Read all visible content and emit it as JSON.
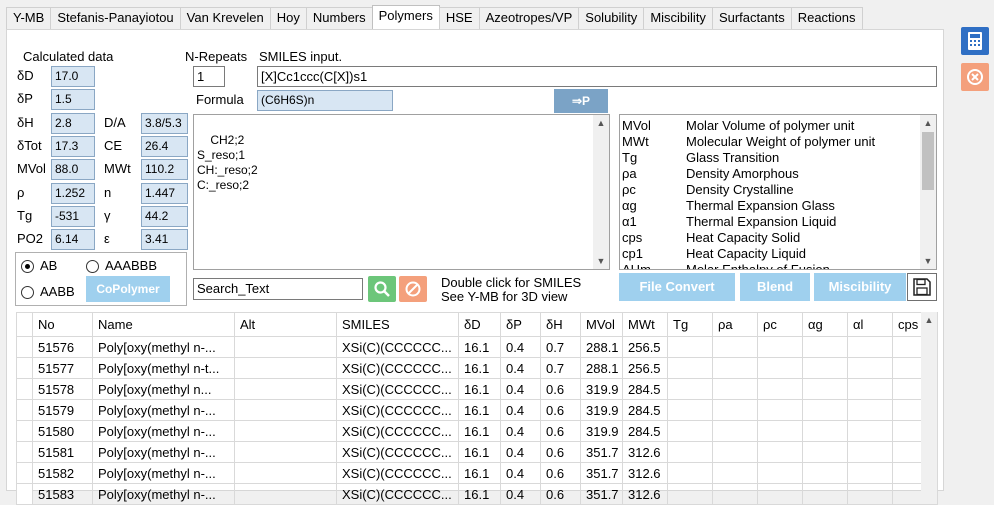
{
  "tabs": [
    "Y-MB",
    "Stefanis-Panayiotou",
    "Van Krevelen",
    "Hoy",
    "Numbers",
    "Polymers",
    "HSE",
    "Azeotropes/VP",
    "Solubility",
    "Miscibility",
    "Surfactants",
    "Reactions"
  ],
  "active_tab": "Polymers",
  "calc": {
    "title": "Calculated data",
    "left": [
      {
        "label": "δD",
        "value": "17.0"
      },
      {
        "label": "δP",
        "value": "1.5"
      },
      {
        "label": "δH",
        "value": "2.8"
      },
      {
        "label": "δTot",
        "value": "17.3"
      },
      {
        "label": "MVol",
        "value": "88.0"
      },
      {
        "label": "ρ",
        "value": "1.252"
      },
      {
        "label": "Tg",
        "value": "-531"
      },
      {
        "label": "PO2",
        "value": "6.14"
      }
    ],
    "right": [
      {
        "label": "D/A",
        "value": "3.8/5.3"
      },
      {
        "label": "CE",
        "value": "26.4"
      },
      {
        "label": "MWt",
        "value": "110.2"
      },
      {
        "label": "n",
        "value": "1.447"
      },
      {
        "label": "γ",
        "value": "44.2"
      },
      {
        "label": "ε",
        "value": "3.41"
      }
    ]
  },
  "nrepeats": {
    "label": "N-Repeats",
    "value": "1"
  },
  "smiles": {
    "label": "SMILES input.",
    "value": "[X]Cc1ccc(C[X])s1"
  },
  "formula": {
    "label": "Formula",
    "value": "(C6H6S)n"
  },
  "convert_button": "⇒P",
  "groups_text": "CH2;2\nS_reso;1\nCH:_reso;2\nC:_reso;2",
  "legend": [
    {
      "k": "MVol",
      "v": "Molar Volume of polymer unit"
    },
    {
      "k": "MWt",
      "v": "Molecular Weight of polymer unit"
    },
    {
      "k": "Tg",
      "v": "Glass Transition"
    },
    {
      "k": "ρa",
      "v": "Density Amorphous"
    },
    {
      "k": "ρc",
      "v": "Density Crystalline"
    },
    {
      "k": "αg",
      "v": "Thermal Expansion Glass"
    },
    {
      "k": "α1",
      "v": "Thermal Expansion Liquid"
    },
    {
      "k": "cps",
      "v": "Heat Capacity Solid"
    },
    {
      "k": "cp1",
      "v": "Heat Capacity Liquid"
    },
    {
      "k": "ΔHm",
      "v": "Molar Enthalpy of Fusion"
    }
  ],
  "copolymer": {
    "options": [
      "AB",
      "AAABBB",
      "AABB"
    ],
    "selected": "AB",
    "button": "CoPolymer"
  },
  "search": {
    "value": "Search_Text"
  },
  "hint_lines": [
    "Double click for SMILES",
    "See Y-MB for 3D view"
  ],
  "action_buttons": [
    "File Convert",
    "Blend",
    "Miscibility"
  ],
  "table": {
    "columns": [
      "No",
      "Name",
      "Alt",
      "SMILES",
      "δD",
      "δP",
      "δH",
      "MVol",
      "MWt",
      "Tg",
      "ρa",
      "ρc",
      "αg",
      "αl",
      "cps"
    ],
    "rows": [
      [
        "51576",
        "Poly[oxy(methyl  n-...",
        "",
        "XSi(C)(CCCCCC...",
        "16.1",
        "0.4",
        "0.7",
        "288.1",
        "256.5",
        "",
        "",
        "",
        "",
        "",
        ""
      ],
      [
        "51577",
        "Poly[oxy(methyl n-t...",
        "",
        "XSi(C)(CCCCCC...",
        "16.1",
        "0.4",
        "0.7",
        "288.1",
        "256.5",
        "",
        "",
        "",
        "",
        "",
        ""
      ],
      [
        "51578",
        "Poly[oxy(methyl    n...",
        "",
        "XSi(C)(CCCCCC...",
        "16.1",
        "0.4",
        "0.6",
        "319.9",
        "284.5",
        "",
        "",
        "",
        "",
        "",
        ""
      ],
      [
        "51579",
        "Poly[oxy(methyl  n-...",
        "",
        "XSi(C)(CCCCCC...",
        "16.1",
        "0.4",
        "0.6",
        "319.9",
        "284.5",
        "",
        "",
        "",
        "",
        "",
        ""
      ],
      [
        "51580",
        "Poly[oxy(methyl  n-...",
        "",
        "XSi(C)(CCCCCC...",
        "16.1",
        "0.4",
        "0.6",
        "319.9",
        "284.5",
        "",
        "",
        "",
        "",
        "",
        ""
      ],
      [
        "51581",
        "Poly[oxy(methyl n-...",
        "",
        "XSi(C)(CCCCCC...",
        "16.1",
        "0.4",
        "0.6",
        "351.7",
        "312.6",
        "",
        "",
        "",
        "",
        "",
        ""
      ],
      [
        "51582",
        "Poly[oxy(methyl  n-...",
        "",
        "XSi(C)(CCCCCC...",
        "16.1",
        "0.4",
        "0.6",
        "351.7",
        "312.6",
        "",
        "",
        "",
        "",
        "",
        ""
      ],
      [
        "51583",
        "Poly[oxy(methyl n-...",
        "",
        "XSi(C)(CCCCCC...",
        "16.1",
        "0.4",
        "0.6",
        "351.7",
        "312.6",
        "",
        "",
        "",
        "",
        "",
        ""
      ]
    ]
  }
}
